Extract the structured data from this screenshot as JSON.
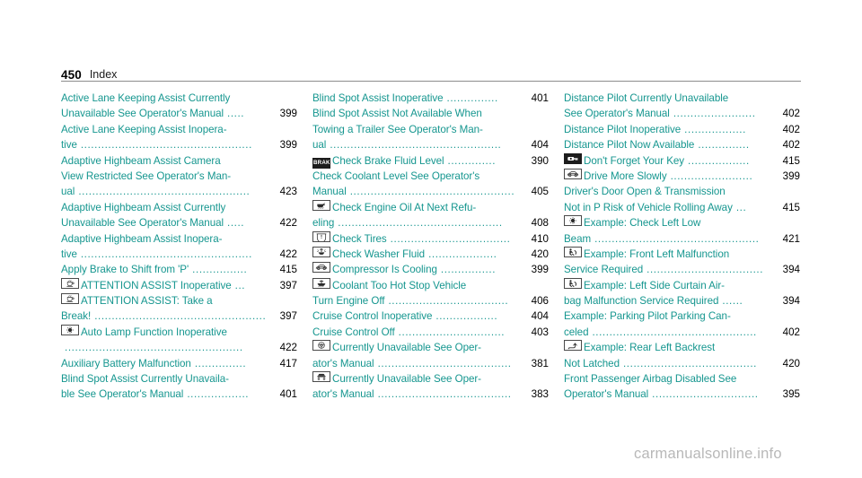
{
  "header": {
    "page_number": "450",
    "section": "Index"
  },
  "watermark": "carmanualsonline.info",
  "colors": {
    "entry_text": "#15968f",
    "page_number": "#000000",
    "rule": "#8d8d8d",
    "watermark": "#b8b8b8"
  },
  "columns": [
    {
      "id": "column-left",
      "entries": [
        {
          "icon": null,
          "lines": [
            {
              "text": "Active Lane Keeping Assist Currently",
              "leader": "",
              "page": ""
            },
            {
              "text": "Unavailable See Operator's Manual",
              "leader": ".....",
              "page": "399"
            }
          ]
        },
        {
          "icon": null,
          "lines": [
            {
              "text": "Active Lane Keeping Assist Inopera-",
              "leader": "",
              "page": ""
            },
            {
              "text": "tive",
              "leader": "..................................................",
              "page": "399"
            }
          ]
        },
        {
          "icon": null,
          "lines": [
            {
              "text": "Adaptive Highbeam Assist Camera",
              "leader": "",
              "page": ""
            },
            {
              "text": "View Restricted See Operator's Man-",
              "leader": "",
              "page": ""
            },
            {
              "text": "ual",
              "leader": "..................................................",
              "page": "423"
            }
          ]
        },
        {
          "icon": null,
          "lines": [
            {
              "text": "Adaptive Highbeam Assist Currently",
              "leader": "",
              "page": ""
            },
            {
              "text": "Unavailable See Operator's Manual",
              "leader": ".....",
              "page": "422"
            }
          ]
        },
        {
          "icon": null,
          "lines": [
            {
              "text": "Adaptive Highbeam Assist Inopera-",
              "leader": "",
              "page": ""
            },
            {
              "text": "tive",
              "leader": "..................................................",
              "page": "422"
            }
          ]
        },
        {
          "icon": null,
          "lines": [
            {
              "text": "Apply Brake to Shift from 'P'",
              "leader": "................",
              "page": "415"
            }
          ]
        },
        {
          "icon": "coffee-cup-icon",
          "lines": [
            {
              "text": "ATTENTION ASSIST Inoperative",
              "leader": "...",
              "page": "397"
            }
          ]
        },
        {
          "icon": "coffee-cup-icon",
          "lines": [
            {
              "text": "ATTENTION ASSIST: Take a",
              "leader": "",
              "page": ""
            },
            {
              "text": "Break!",
              "leader": "..................................................",
              "page": "397"
            }
          ]
        },
        {
          "icon": "lamp-icon",
          "lines": [
            {
              "text": "Auto Lamp Function Inoperative",
              "leader": "",
              "page": ""
            },
            {
              "text": "",
              "leader": "....................................................",
              "page": "422"
            }
          ]
        },
        {
          "icon": null,
          "lines": [
            {
              "text": "Auxiliary Battery Malfunction",
              "leader": "...............",
              "page": "417"
            }
          ]
        },
        {
          "icon": null,
          "lines": [
            {
              "text": "Blind Spot Assist Currently Unavaila-",
              "leader": "",
              "page": ""
            },
            {
              "text": "ble See Operator's Manual",
              "leader": "..................",
              "page": "401"
            }
          ]
        }
      ]
    },
    {
      "id": "column-middle",
      "entries": [
        {
          "icon": null,
          "lines": [
            {
              "text": "Blind Spot Assist Inoperative",
              "leader": "...............",
              "page": "401"
            }
          ]
        },
        {
          "icon": null,
          "lines": [
            {
              "text": "Blind Spot Assist Not Available When",
              "leader": "",
              "page": ""
            },
            {
              "text": "Towing a Trailer See Operator's Man-",
              "leader": "",
              "page": ""
            },
            {
              "text": "ual",
              "leader": "..................................................",
              "page": "404"
            }
          ]
        },
        {
          "icon": "brake-icon",
          "lines": [
            {
              "text": "Check Brake Fluid Level",
              "leader": "..............",
              "page": "390"
            }
          ]
        },
        {
          "icon": null,
          "lines": [
            {
              "text": "Check Coolant Level See Operator's",
              "leader": "",
              "page": ""
            },
            {
              "text": "Manual",
              "leader": "................................................",
              "page": "405"
            }
          ]
        },
        {
          "icon": "oil-can-icon",
          "lines": [
            {
              "text": "Check Engine Oil At Next Refu-",
              "leader": "",
              "page": ""
            },
            {
              "text": "eling",
              "leader": "................................................",
              "page": "408"
            }
          ]
        },
        {
          "icon": "tire-pressure-icon",
          "lines": [
            {
              "text": "Check Tires",
              "leader": "...................................",
              "page": "410"
            }
          ]
        },
        {
          "icon": "washer-fluid-icon",
          "lines": [
            {
              "text": "Check Washer Fluid",
              "leader": "....................",
              "page": "420"
            }
          ]
        },
        {
          "icon": "car-icon",
          "lines": [
            {
              "text": "Compressor Is Cooling",
              "leader": "................",
              "page": "399"
            }
          ]
        },
        {
          "icon": "coolant-temp-icon",
          "lines": [
            {
              "text": "Coolant Too Hot Stop Vehicle",
              "leader": "",
              "page": ""
            },
            {
              "text": "Turn Engine Off",
              "leader": "...................................",
              "page": "406"
            }
          ]
        },
        {
          "icon": null,
          "lines": [
            {
              "text": "Cruise Control Inoperative",
              "leader": "..................",
              "page": "404"
            }
          ]
        },
        {
          "icon": null,
          "lines": [
            {
              "text": "Cruise Control Off",
              "leader": "...............................",
              "page": "403"
            }
          ]
        },
        {
          "icon": "steering-icon",
          "lines": [
            {
              "text": "Currently Unavailable See Oper-",
              "leader": "",
              "page": ""
            },
            {
              "text": "ator's Manual",
              "leader": ".......................................",
              "page": "381"
            }
          ]
        },
        {
          "icon": "suspension-icon",
          "lines": [
            {
              "text": "Currently Unavailable See Oper-",
              "leader": "",
              "page": ""
            },
            {
              "text": "ator's Manual",
              "leader": ".......................................",
              "page": "383"
            }
          ]
        }
      ]
    },
    {
      "id": "column-right",
      "entries": [
        {
          "icon": null,
          "lines": [
            {
              "text": "Distance Pilot Currently Unavailable",
              "leader": "",
              "page": ""
            },
            {
              "text": "See Operator's Manual",
              "leader": "........................",
              "page": "402"
            }
          ]
        },
        {
          "icon": null,
          "lines": [
            {
              "text": "Distance Pilot Inoperative",
              "leader": "..................",
              "page": "402"
            }
          ]
        },
        {
          "icon": null,
          "lines": [
            {
              "text": "Distance Pilot Now Available",
              "leader": "...............",
              "page": "402"
            }
          ]
        },
        {
          "icon": "key-icon",
          "lines": [
            {
              "text": "Don't Forget Your Key",
              "leader": "..................",
              "page": "415"
            }
          ]
        },
        {
          "icon": "car-icon",
          "lines": [
            {
              "text": "Drive More Slowly",
              "leader": "........................",
              "page": "399"
            }
          ]
        },
        {
          "icon": null,
          "lines": [
            {
              "text": "Driver's Door Open & Transmission",
              "leader": "",
              "page": ""
            },
            {
              "text": "Not in P Risk of Vehicle Rolling Away",
              "leader": "...",
              "page": "415"
            }
          ]
        },
        {
          "icon": "lamp-icon",
          "lines": [
            {
              "text": "Example: Check Left Low",
              "leader": "",
              "page": ""
            },
            {
              "text": "Beam",
              "leader": "................................................",
              "page": "421"
            }
          ]
        },
        {
          "icon": "airbag-icon",
          "lines": [
            {
              "text": "Example: Front Left Malfunction",
              "leader": "",
              "page": ""
            },
            {
              "text": "Service Required",
              "leader": "..................................",
              "page": "394"
            }
          ]
        },
        {
          "icon": "airbag-icon",
          "lines": [
            {
              "text": "Example: Left Side Curtain Air-",
              "leader": "",
              "page": ""
            },
            {
              "text": "bag Malfunction Service Required",
              "leader": "......",
              "page": "394"
            }
          ]
        },
        {
          "icon": null,
          "lines": [
            {
              "text": "Example: Parking Pilot Parking Can-",
              "leader": "",
              "page": ""
            },
            {
              "text": "celed",
              "leader": "................................................",
              "page": "402"
            }
          ]
        },
        {
          "icon": "seat-backrest-icon",
          "lines": [
            {
              "text": "Example: Rear Left Backrest",
              "leader": "",
              "page": ""
            },
            {
              "text": "Not Latched",
              "leader": ".......................................",
              "page": "420"
            }
          ]
        },
        {
          "icon": null,
          "lines": [
            {
              "text": "Front Passenger Airbag Disabled See",
              "leader": "",
              "page": ""
            },
            {
              "text": "Operator's Manual",
              "leader": "...............................",
              "page": "395"
            }
          ]
        }
      ]
    }
  ]
}
